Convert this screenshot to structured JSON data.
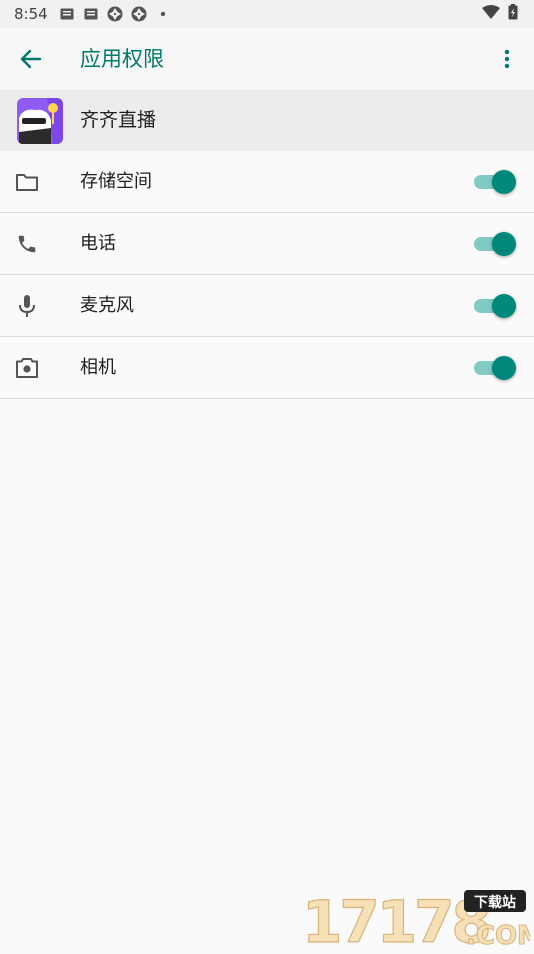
{
  "status_bar": {
    "time": "8:54",
    "icons": [
      "mail-icon",
      "mail-icon",
      "aperture-icon",
      "aperture-icon",
      "dot-icon"
    ],
    "right_icons": [
      "wifi-icon",
      "battery-icon"
    ]
  },
  "app_bar": {
    "back_icon": "arrow-back-icon",
    "title": "应用权限",
    "more_icon": "more-vert-icon"
  },
  "app": {
    "name": "齐齐直播",
    "icon": "app-icon"
  },
  "permissions": [
    {
      "label": "存储空间",
      "icon": "folder-icon",
      "enabled": true
    },
    {
      "label": "电话",
      "icon": "phone-icon",
      "enabled": true
    },
    {
      "label": "麦克风",
      "icon": "mic-icon",
      "enabled": true
    },
    {
      "label": "相机",
      "icon": "camera-icon",
      "enabled": true
    }
  ],
  "watermark": {
    "number": "17178",
    "tag": "下载站",
    "domain": ".COM"
  },
  "colors": {
    "accent": "#00796b",
    "toggle_thumb": "#00897b",
    "toggle_track": "#80cbc4",
    "app_row_bg": "#ececec",
    "background": "#fafafa"
  }
}
